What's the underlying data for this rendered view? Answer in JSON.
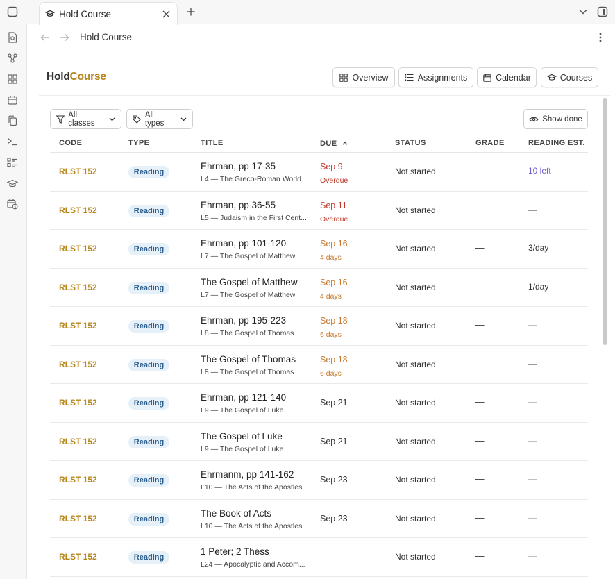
{
  "tab": {
    "title": "Hold Course"
  },
  "nav": {
    "title": "Hold Course"
  },
  "brand": {
    "part1": "Hold",
    "part2": "Course"
  },
  "views": [
    {
      "label": "Overview",
      "icon": "grid-icon"
    },
    {
      "label": "Assignments",
      "icon": "list-icon"
    },
    {
      "label": "Calendar",
      "icon": "calendar-icon"
    },
    {
      "label": "Courses",
      "icon": "graduation-cap-icon"
    }
  ],
  "filters": {
    "classes": "All classes",
    "types": "All types",
    "show_done": "Show done"
  },
  "columns": {
    "code": "CODE",
    "type": "TYPE",
    "title": "TITLE",
    "due": "DUE",
    "status": "STATUS",
    "grade": "GRADE",
    "reading_est": "READING EST."
  },
  "colors": {
    "accent": "#b8861b",
    "overdue": "#c0392b",
    "soon": "#c87a2e",
    "badge_bg": "#e6f0f9",
    "badge_text": "#2b5d8c",
    "left_text": "#6a5acd"
  },
  "rows": [
    {
      "code": "RLST 152",
      "type": "Reading",
      "title": "Ehrman, pp 17-35",
      "subtitle": "L4 — The Greco-Roman World",
      "due": "Sep 9",
      "due_sub": "Overdue",
      "due_state": "overdue",
      "status": "Not started",
      "grade": "—",
      "reading": "10 left",
      "reading_state": "left"
    },
    {
      "code": "RLST 152",
      "type": "Reading",
      "title": "Ehrman, pp 36-55",
      "subtitle": "L5 — Judaism in the First Cent...",
      "due": "Sep 11",
      "due_sub": "Overdue",
      "due_state": "overdue",
      "status": "Not started",
      "grade": "—",
      "reading": "—",
      "reading_state": ""
    },
    {
      "code": "RLST 152",
      "type": "Reading",
      "title": "Ehrman, pp 101-120",
      "subtitle": "L7 — The Gospel of Matthew",
      "due": "Sep 16",
      "due_sub": "4 days",
      "due_state": "soon",
      "status": "Not started",
      "grade": "—",
      "reading": "3/day",
      "reading_state": ""
    },
    {
      "code": "RLST 152",
      "type": "Reading",
      "title": "The Gospel of Matthew",
      "subtitle": "L7 — The Gospel of Matthew",
      "due": "Sep 16",
      "due_sub": "4 days",
      "due_state": "soon",
      "status": "Not started",
      "grade": "—",
      "reading": "1/day",
      "reading_state": ""
    },
    {
      "code": "RLST 152",
      "type": "Reading",
      "title": "Ehrman, pp 195-223",
      "subtitle": "L8 — The Gospel of Thomas",
      "due": "Sep 18",
      "due_sub": "6 days",
      "due_state": "soon",
      "status": "Not started",
      "grade": "—",
      "reading": "—",
      "reading_state": ""
    },
    {
      "code": "RLST 152",
      "type": "Reading",
      "title": "The Gospel of Thomas",
      "subtitle": "L8 — The Gospel of Thomas",
      "due": "Sep 18",
      "due_sub": "6 days",
      "due_state": "soon",
      "status": "Not started",
      "grade": "—",
      "reading": "—",
      "reading_state": ""
    },
    {
      "code": "RLST 152",
      "type": "Reading",
      "title": "Ehrman, pp 121-140",
      "subtitle": "L9 — The Gospel of Luke",
      "due": "Sep 21",
      "due_sub": "",
      "due_state": "",
      "status": "Not started",
      "grade": "—",
      "reading": "—",
      "reading_state": ""
    },
    {
      "code": "RLST 152",
      "type": "Reading",
      "title": "The Gospel of Luke",
      "subtitle": "L9 — The Gospel of Luke",
      "due": "Sep 21",
      "due_sub": "",
      "due_state": "",
      "status": "Not started",
      "grade": "—",
      "reading": "—",
      "reading_state": ""
    },
    {
      "code": "RLST 152",
      "type": "Reading",
      "title": "Ehrmanm, pp 141-162",
      "subtitle": "L10 — The Acts of the Apostles",
      "due": "Sep 23",
      "due_sub": "",
      "due_state": "",
      "status": "Not started",
      "grade": "—",
      "reading": "—",
      "reading_state": ""
    },
    {
      "code": "RLST 152",
      "type": "Reading",
      "title": "The Book of Acts",
      "subtitle": "L10 — The Acts of the Apostles",
      "due": "Sep 23",
      "due_sub": "",
      "due_state": "",
      "status": "Not started",
      "grade": "—",
      "reading": "—",
      "reading_state": ""
    },
    {
      "code": "RLST 152",
      "type": "Reading",
      "title": "1 Peter; 2 Thess",
      "subtitle": "L24 — Apocalyptic and Accom...",
      "due": "—",
      "due_sub": "",
      "due_state": "",
      "status": "Not started",
      "grade": "—",
      "reading": "—",
      "reading_state": ""
    }
  ]
}
